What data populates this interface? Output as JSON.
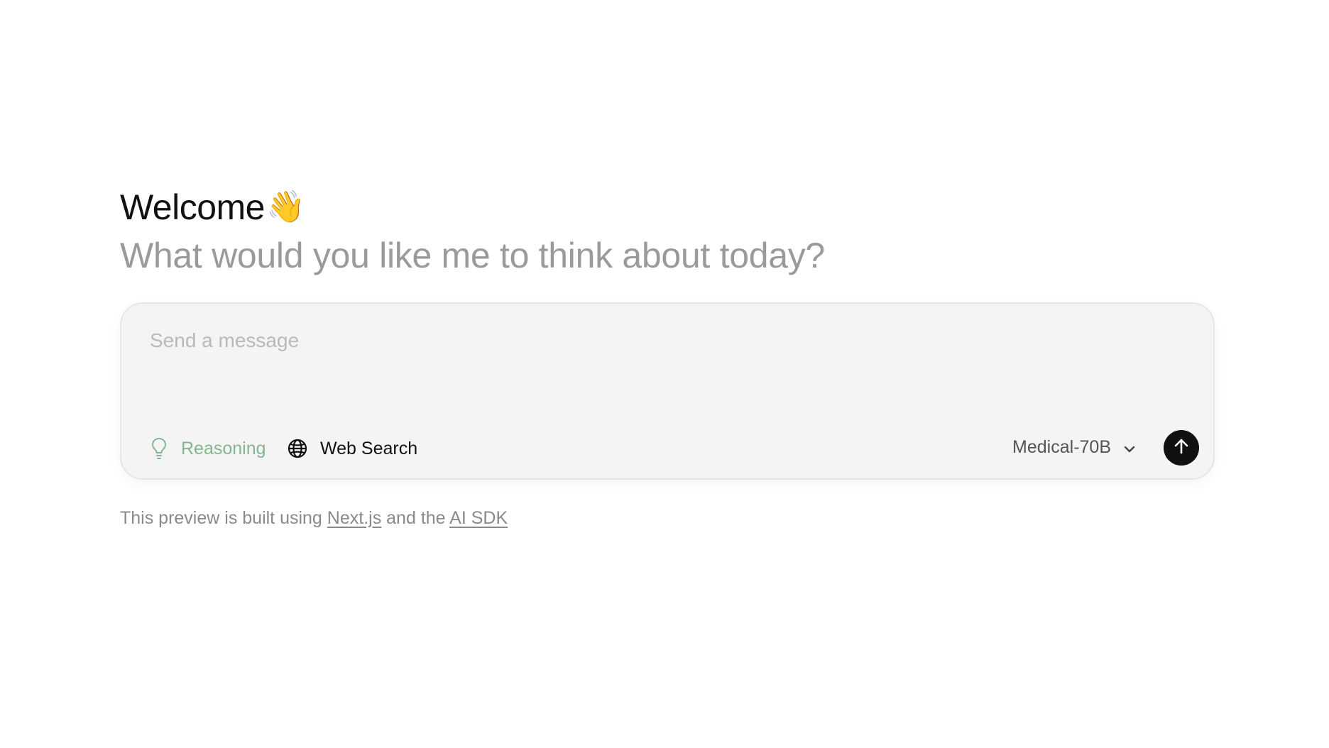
{
  "greeting": {
    "title": "Welcome",
    "emoji": "👋",
    "subtitle": "What would you like me to think about today?"
  },
  "composer": {
    "placeholder": "Send a message",
    "value": "",
    "tools": {
      "reasoning_label": "Reasoning",
      "web_search_label": "Web Search"
    },
    "model": {
      "selected": "Medical-70B"
    },
    "icons": {
      "reasoning": "lightbulb-icon",
      "web_search": "globe-icon",
      "model": "chevron-down-icon",
      "send": "arrow-up-icon"
    },
    "colors": {
      "reasoning_active": "#84b58f",
      "send_button": "#111111"
    }
  },
  "footer": {
    "prefix": "This preview is built using",
    "link1": "Next.js",
    "middle": "and the",
    "link2": "AI SDK"
  }
}
